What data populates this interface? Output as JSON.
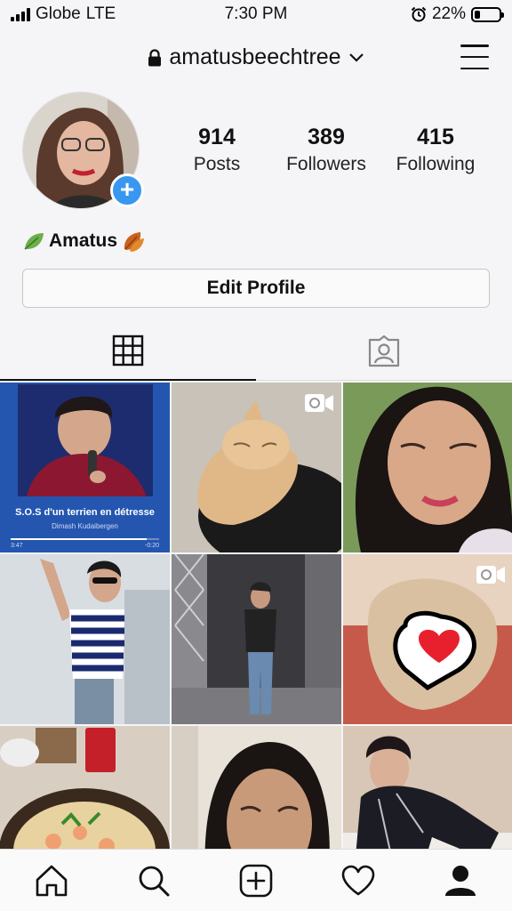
{
  "status_bar": {
    "carrier": "Globe",
    "network": "LTE",
    "time": "7:30 PM",
    "battery": "22%",
    "battery_level": 0.22
  },
  "header": {
    "username": "amatusbeechtree"
  },
  "profile": {
    "display_name": "Amatus",
    "stats": [
      {
        "value": "914",
        "label": "Posts"
      },
      {
        "value": "389",
        "label": "Followers"
      },
      {
        "value": "415",
        "label": "Following"
      }
    ],
    "edit_button": "Edit Profile"
  },
  "tabs": [
    {
      "icon": "grid-icon",
      "active": true
    },
    {
      "icon": "tagged-icon",
      "active": false
    }
  ],
  "posts": [
    {
      "kind": "music-card",
      "title": "S.O.S d'un terrien en détresse",
      "artist": "Dimash Kudaibergen",
      "time_elapsed": "3:47",
      "time_remaining": "-0:20"
    },
    {
      "kind": "cat-video",
      "video": true
    },
    {
      "kind": "selfie"
    },
    {
      "kind": "man-striped-shirt"
    },
    {
      "kind": "stage"
    },
    {
      "kind": "cat-heart",
      "video": true
    },
    {
      "kind": "food"
    },
    {
      "kind": "selfie-2"
    },
    {
      "kind": "man-pajamas"
    }
  ],
  "bottom_nav": [
    {
      "icon": "home-icon"
    },
    {
      "icon": "search-icon"
    },
    {
      "icon": "add-post-icon"
    },
    {
      "icon": "heart-icon"
    },
    {
      "icon": "profile-icon"
    }
  ],
  "colors": {
    "accent": "#3897f0",
    "background": "#f5f4f7"
  }
}
